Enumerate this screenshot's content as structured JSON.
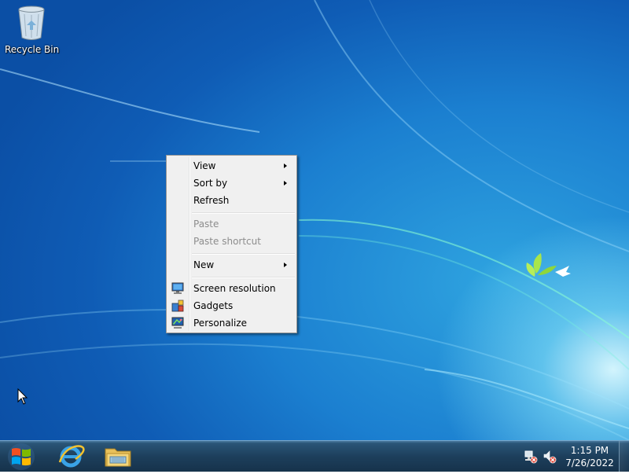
{
  "desktop": {
    "icons": [
      {
        "label": "Recycle Bin",
        "icon": "recycle-bin-icon"
      }
    ]
  },
  "context_menu": {
    "items": [
      {
        "label": "View",
        "submenu": true,
        "enabled": true
      },
      {
        "label": "Sort by",
        "submenu": true,
        "enabled": true
      },
      {
        "label": "Refresh",
        "submenu": false,
        "enabled": true
      },
      {
        "label": "Paste",
        "submenu": false,
        "enabled": false
      },
      {
        "label": "Paste shortcut",
        "submenu": false,
        "enabled": false
      },
      {
        "label": "New",
        "submenu": true,
        "enabled": true
      },
      {
        "label": "Screen resolution",
        "submenu": false,
        "enabled": true,
        "icon": "monitor-icon"
      },
      {
        "label": "Gadgets",
        "submenu": false,
        "enabled": true,
        "icon": "gadgets-icon"
      },
      {
        "label": "Personalize",
        "submenu": false,
        "enabled": true,
        "icon": "personalize-icon"
      }
    ]
  },
  "taskbar": {
    "start": {
      "icon": "windows-logo-icon"
    },
    "pinned": [
      {
        "icon": "internet-explorer-icon"
      },
      {
        "icon": "file-explorer-icon"
      }
    ],
    "tray": {
      "network": {
        "icon": "network-warning-icon"
      },
      "volume": {
        "icon": "volume-muted-icon"
      },
      "time": "1:15 PM",
      "date": "7/26/2022"
    }
  },
  "colors": {
    "desktop_blue": "#1b7fd0",
    "menu_background": "#f0f0f0",
    "menu_border": "#979797",
    "disabled_text": "#8d8d8d",
    "taskbar": "#1d3f5c"
  }
}
